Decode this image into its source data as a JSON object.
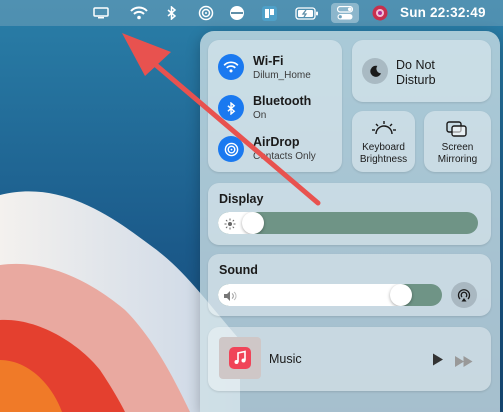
{
  "menubar": {
    "clock": "Sun 22:32:49",
    "icons": [
      "display-icon",
      "wifi-icon",
      "bluetooth-icon",
      "airdrop-icon",
      "status-icon",
      "app-icon",
      "battery-icon",
      "control-center-icon",
      "siri-icon"
    ]
  },
  "control_center": {
    "wifi": {
      "title": "Wi-Fi",
      "subtitle": "Dilum_Home"
    },
    "bluetooth": {
      "title": "Bluetooth",
      "subtitle": "On"
    },
    "airdrop": {
      "title": "AirDrop",
      "subtitle": "Contacts Only"
    },
    "dnd": {
      "line1": "Do Not",
      "line2": "Disturb"
    },
    "keyboard": {
      "line1": "Keyboard",
      "line2": "Brightness"
    },
    "mirroring": {
      "line1": "Screen",
      "line2": "Mirroring"
    },
    "display": {
      "label": "Display",
      "level": 0.1
    },
    "sound": {
      "label": "Sound",
      "level": 0.85
    },
    "music": {
      "label": "Music"
    }
  },
  "colors": {
    "accent": "#1a79f0",
    "arrow": "#e8524f"
  }
}
